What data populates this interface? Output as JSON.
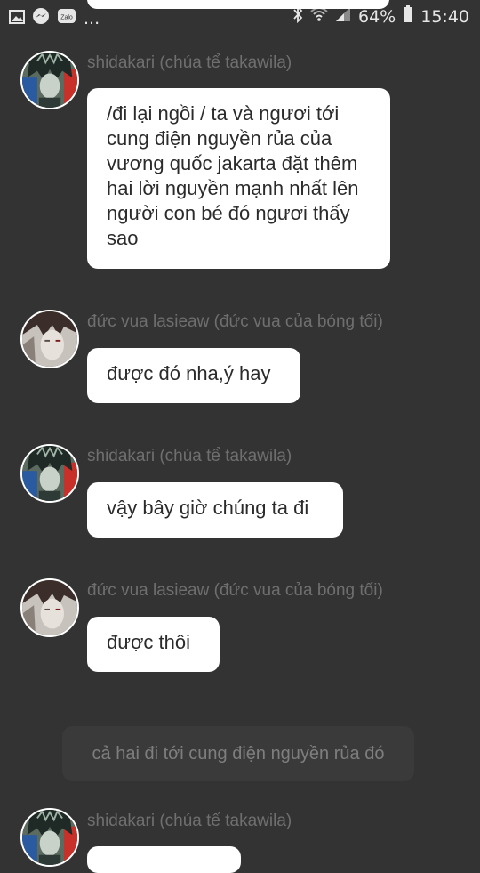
{
  "status_bar": {
    "notification_icons": [
      "gallery-icon",
      "messenger-icon",
      "zalo-icon"
    ],
    "zalo_label": "Zalo",
    "more_indicator": "...",
    "battery_percent": "64%",
    "time": "15:40"
  },
  "messages": [
    {
      "sender": "shidakari (chúa tể takawila)",
      "text": "/đi lại ngồi / ta và ngươi tới cung điện nguyền rủa của vương quốc jakarta đặt thêm hai lời nguyền mạnh nhất lên người con bé đó ngươi thấy sao"
    },
    {
      "sender": "đức vua lasieaw (đức vua của bóng tối)",
      "text": "được đó nha,ý hay"
    },
    {
      "sender": "shidakari (chúa tể takawila)",
      "text": "vậy bây giờ chúng ta đi"
    },
    {
      "sender": "đức vua lasieaw (đức vua của bóng tối)",
      "text": "được thôi"
    }
  ],
  "narration": "cả hai đi tới cung điện nguyền rủa đó",
  "last_sender": "shidakari (chúa tể takawila)"
}
